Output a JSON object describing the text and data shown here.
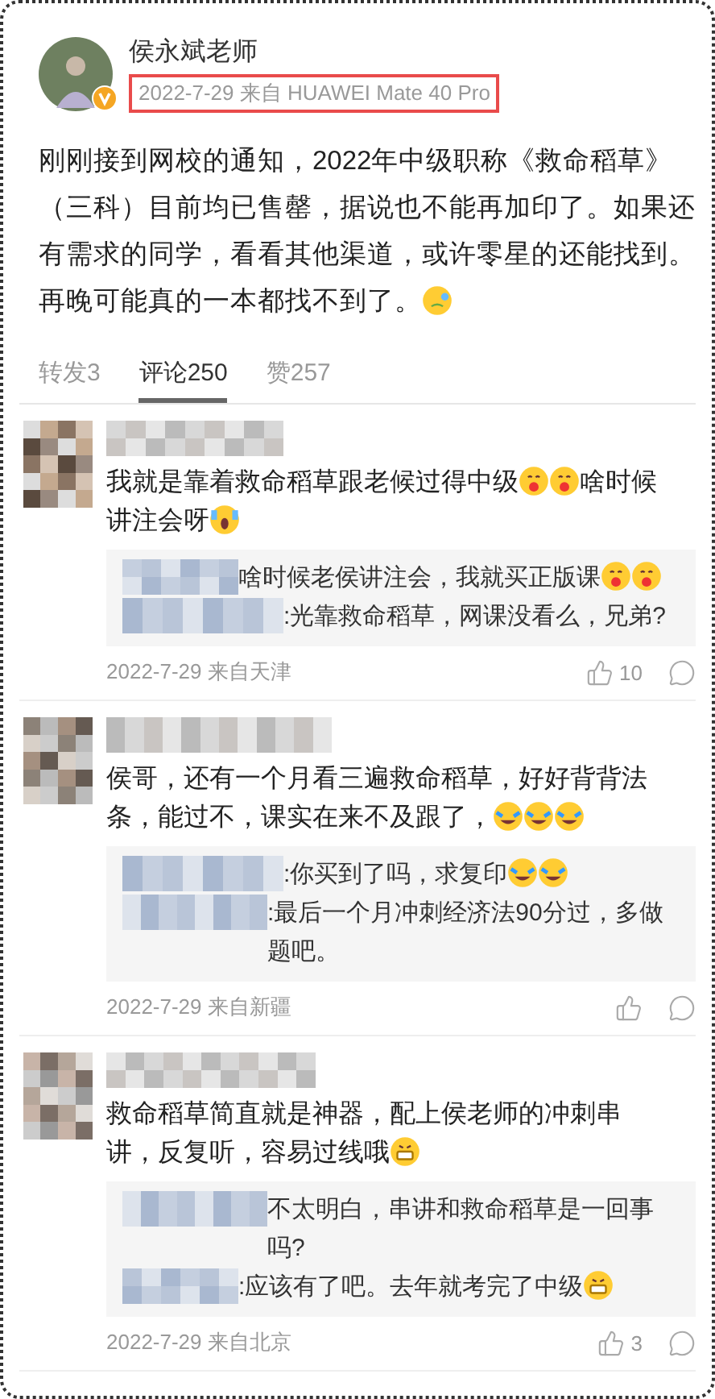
{
  "post": {
    "author": "侯永斌老师",
    "verified": true,
    "meta": "2022-7-29 来自 HUAWEI Mate 40 Pro",
    "content": [
      {
        "kind": "text",
        "text": "刚刚接到网校的通知，2022年中级职称《救命稻草》"
      },
      {
        "kind": "text",
        "text": "（三科）目前均已售罄，据说也不能再加印了。如果还"
      },
      {
        "kind": "text",
        "text": "有需求的同学，看看其他渠道，或许零星的还能找到。"
      },
      {
        "kind": "text",
        "text": "再晚可能真的一本都找不到了。"
      },
      {
        "kind": "sweat"
      }
    ]
  },
  "tabs": [
    {
      "label": "转发3",
      "selected": false
    },
    {
      "label": "评论250",
      "selected": true
    },
    {
      "label": "赞257",
      "selected": false
    }
  ],
  "comments": [
    {
      "content": [
        {
          "kind": "text",
          "text": "我就是靠着救命稻草跟老候过得中级"
        },
        {
          "kind": "blush"
        },
        {
          "kind": "blush"
        },
        {
          "kind": "text",
          "text": "啥时候"
        },
        {
          "kind": "text",
          "text": "讲注会呀"
        },
        {
          "kind": "scream"
        }
      ],
      "replies": [
        {
          "content": [
            {
              "kind": "text",
              "text": "啥时候老侯讲注会，我就买正版课"
            },
            {
              "kind": "blush"
            },
            {
              "kind": "blush"
            }
          ]
        },
        {
          "content": [
            {
              "kind": "text",
              "text": ":光靠救命稻草，网课没看么，兄弟?"
            }
          ]
        }
      ],
      "date": "2022-7-29 来自天津",
      "likes": "10"
    },
    {
      "content": [
        {
          "kind": "text",
          "text": "侯哥，还有一个月看三遍救命稻草，好好背背法"
        },
        {
          "kind": "text",
          "text": "条，能过不，课实在来不及跟了，"
        },
        {
          "kind": "tears"
        },
        {
          "kind": "tears"
        },
        {
          "kind": "tears"
        }
      ],
      "replies": [
        {
          "content": [
            {
              "kind": "text",
              "text": ":你买到了吗，求复印"
            },
            {
              "kind": "tears"
            },
            {
              "kind": "tears"
            }
          ]
        },
        {
          "content": [
            {
              "kind": "text",
              "text": ":最后一个月冲刺经济法90分过，多做题吧。"
            }
          ]
        }
      ],
      "date": "2022-7-29 来自新疆"
    },
    {
      "content": [
        {
          "kind": "text",
          "text": "救命稻草简直就是神器，配上侯老师的冲刺串"
        },
        {
          "kind": "text",
          "text": "讲，反复听，容易过线哦"
        },
        {
          "kind": "grin"
        }
      ],
      "replies": [
        {
          "content": [
            {
              "kind": "text",
              "text": "不太明白，串讲和救命稻草是一回事吗?"
            }
          ]
        },
        {
          "content": [
            {
              "kind": "text",
              "text": ":应该有了吧。去年就考完了中级"
            },
            {
              "kind": "grin"
            }
          ]
        }
      ],
      "date": "2022-7-29 来自北京",
      "likes": "3"
    }
  ]
}
